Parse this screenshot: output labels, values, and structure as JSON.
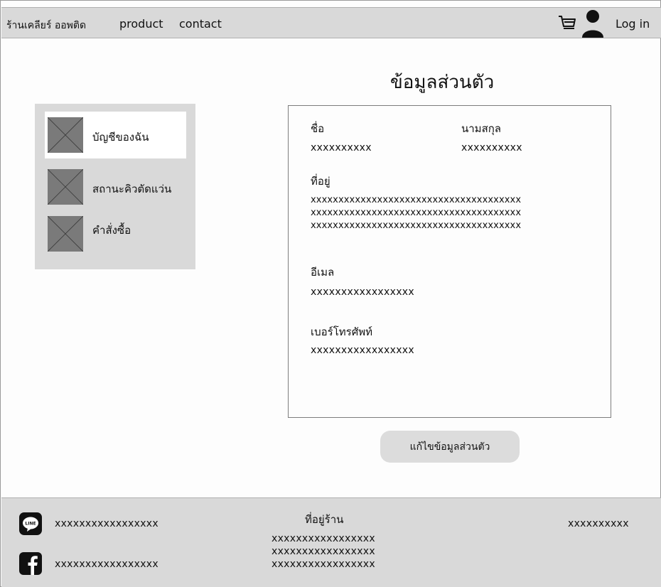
{
  "header": {
    "brand": "ร้านเคลียร์ ออพติด",
    "nav": {
      "product": "product",
      "contact": "contact"
    },
    "login_label": "Log in",
    "cart_icon": "cart-icon",
    "user_icon": "user-icon"
  },
  "page_title": "ข้อมูลส่วนตัว",
  "sidebar": {
    "items": [
      {
        "label": "บัญชีของฉัน",
        "active": true,
        "icon": "image-placeholder-icon"
      },
      {
        "label": "สถานะคิวตัดแว่น",
        "active": false,
        "icon": "image-placeholder-icon"
      },
      {
        "label": "คำสั่งซื้อ",
        "active": false,
        "icon": "image-placeholder-icon"
      }
    ]
  },
  "profile": {
    "first_name_label": "ชื่อ",
    "first_name_value": "xxxxxxxxxx",
    "last_name_label": "นามสกุล",
    "last_name_value": "xxxxxxxxxx",
    "address_label": "ที่อยู่",
    "address_lines": [
      "xxxxxxxxxxxxxxxxxxxxxxxxxxxxxxxxxxxxxx",
      "xxxxxxxxxxxxxxxxxxxxxxxxxxxxxxxxxxxxxx",
      "xxxxxxxxxxxxxxxxxxxxxxxxxxxxxxxxxxxxxx"
    ],
    "email_label": "อีเมล",
    "email_value": "xxxxxxxxxxxxxxxxx",
    "phone_label": "เบอร์โทรศัพท์",
    "phone_value": "xxxxxxxxxxxxxxxxx"
  },
  "edit_button_label": "แก้ไขข้อมูลส่วนตัว",
  "footer": {
    "line_text": "xxxxxxxxxxxxxxxxx",
    "facebook_text": "xxxxxxxxxxxxxxxxx",
    "address_title": "ที่อยู่ร้าน",
    "address_lines": [
      "xxxxxxxxxxxxxxxxx",
      "xxxxxxxxxxxxxxxxx",
      "xxxxxxxxxxxxxxxxx"
    ],
    "right_text": "xxxxxxxxxx",
    "line_icon": "line-icon",
    "facebook_icon": "facebook-icon"
  },
  "colors": {
    "bar_gray": "#d9d9d9",
    "placeholder_gray": "#7a7a7a",
    "button_gray": "#dcdcdc"
  }
}
